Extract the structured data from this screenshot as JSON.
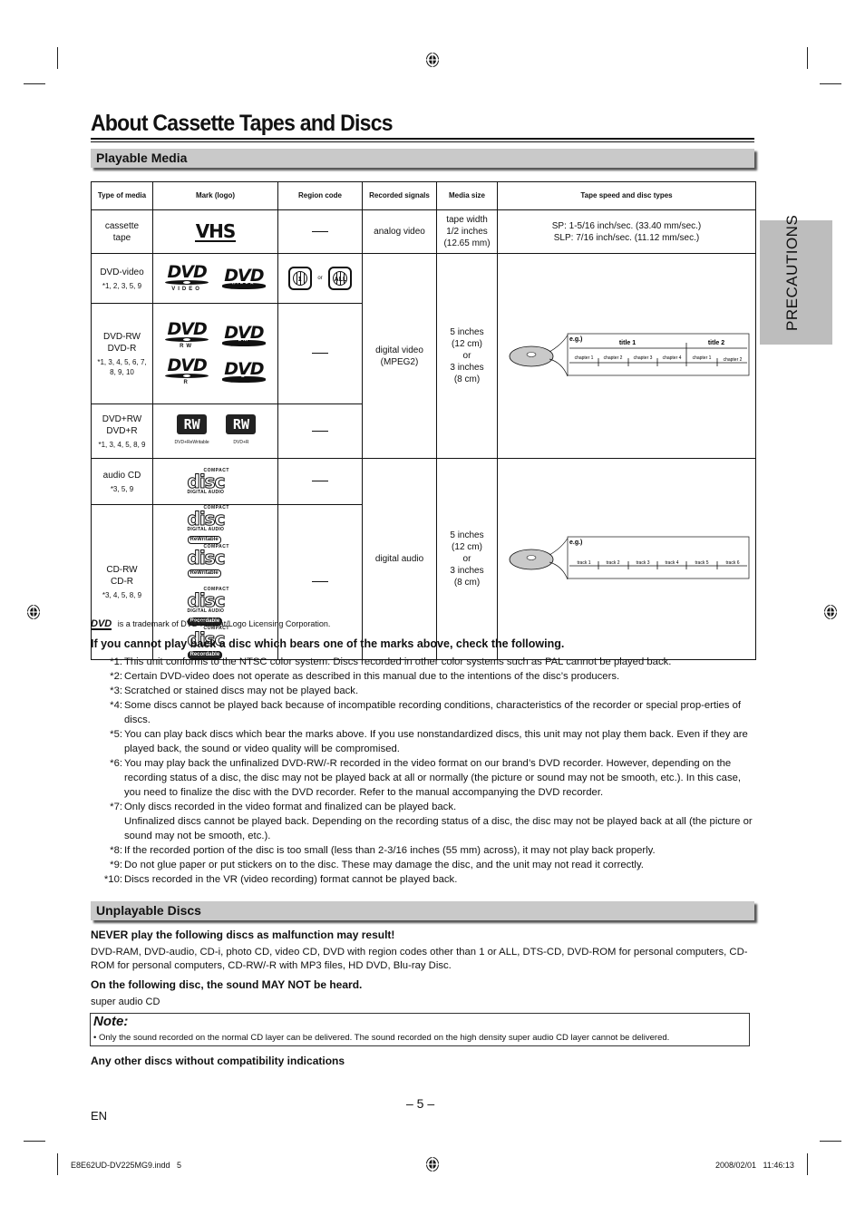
{
  "page_title": "About Cassette Tapes and Discs",
  "side_tab": "PRECAUTIONS",
  "sections": {
    "playable": "Playable Media",
    "unplayable": "Unplayable Discs"
  },
  "table": {
    "headers": [
      "Type of media",
      "Mark (logo)",
      "Region code",
      "Recorded signals",
      "Media size",
      "Tape speed and disc types"
    ],
    "rows": [
      {
        "type": "cassette tape",
        "footnotes": "",
        "logo": "VHS",
        "region": "—",
        "signals": "analog video",
        "size": "tape width 1/2 inches (12.65 mm)",
        "speed": [
          "SP: 1-5/16 inch/sec. (33.40 mm/sec.)",
          "SLP: 7/16 inch/sec. (11.12 mm/sec.)"
        ]
      },
      {
        "type": "DVD-video",
        "footnotes": "*1, 2, 3, 5, 9",
        "logos": [
          "DVD VIDEO",
          "DVD VIDEO"
        ],
        "region_codes": [
          "1",
          "ALL"
        ],
        "region_or": "or"
      },
      {
        "type_lines": [
          "DVD-RW",
          "DVD-R"
        ],
        "footnotes": "*1, 3, 4, 5, 6, 7, 8, 9, 10",
        "logos": [
          "DVD RW",
          "DVD RW",
          "DVD R",
          "DVD R"
        ],
        "region": "—"
      },
      {
        "type_lines": [
          "DVD+RW",
          "DVD+R"
        ],
        "footnotes": "*1, 3, 4, 5, 8, 9",
        "logos": [
          {
            "mark": "RW",
            "caption": "DVD+ReWritable"
          },
          {
            "mark": "RW",
            "caption": "DVD+R"
          }
        ],
        "region": "—"
      },
      {
        "type": "audio CD",
        "footnotes": "*3, 5, 9",
        "logo": {
          "top": "COMPACT",
          "word": "disc",
          "bottom": "DIGITAL AUDIO"
        },
        "region": "—"
      },
      {
        "type_lines": [
          "CD-RW",
          "CD-R"
        ],
        "footnotes": "*3, 4, 5, 8, 9",
        "logos": [
          {
            "top": "COMPACT",
            "word": "disc",
            "bottom": "DIGITAL AUDIO",
            "pill": "ReWritable"
          },
          {
            "top": "COMPACT",
            "word": "disc",
            "bottom": "",
            "pill": "ReWritable"
          },
          {
            "top": "COMPACT",
            "word": "disc",
            "bottom": "DIGITAL AUDIO",
            "pill": "Recordable"
          },
          {
            "top": "COMPACT",
            "word": "disc",
            "bottom": "",
            "pill": "Recordable"
          }
        ],
        "region": "—"
      }
    ],
    "dvd_group": {
      "signals": "digital video (MPEG2)",
      "size_lines": [
        "5 inches",
        "(12 cm)",
        "or",
        "3 inches",
        "(8 cm)"
      ]
    },
    "cd_group": {
      "signals": "digital audio",
      "size_lines": [
        "5 inches",
        "(12 cm)",
        "or",
        "3 inches",
        "(8 cm)"
      ]
    },
    "dvd_diagram": {
      "eg": "e.g.)",
      "titles": [
        "title 1",
        "title 2"
      ],
      "chapters": [
        "chapter 1",
        "chapter 2",
        "chapter 3",
        "chapter 4",
        "chapter 1",
        "chapter 2"
      ]
    },
    "cd_diagram": {
      "eg": "e.g.)",
      "tracks": [
        "track 1",
        "track 2",
        "track 3",
        "track 4",
        "track 5",
        "track 6"
      ]
    }
  },
  "trademark": {
    "logo": "DVD",
    "text": "is a trademark of DVD Format/Logo Licensing Corporation."
  },
  "check_heading": "If you cannot play back a disc which bears one of the marks above, check the following.",
  "notes": [
    {
      "key": "*1:",
      "text": "This unit conforms to the NTSC color system. Discs recorded in other color systems such as PAL cannot be played back."
    },
    {
      "key": "*2:",
      "text": "Certain DVD-video does not operate as described in this manual due to the intentions of the disc’s producers."
    },
    {
      "key": "*3:",
      "text": "Scratched or stained discs may not be played back."
    },
    {
      "key": "*4:",
      "text": "Some discs cannot be played back because of incompatible recording conditions, characteristics of the recorder or special prop-erties of discs."
    },
    {
      "key": "*5:",
      "text": "You can play back discs which bear the marks above. If you use nonstandardized discs, this unit may not play them back. Even if they are played back, the sound or video quality will be compromised."
    },
    {
      "key": "*6:",
      "text": "You may play back the unfinalized DVD-RW/-R recorded in the video format on our brand’s DVD recorder. However, depending on the recording status of a disc, the disc may not be played back at all or normally (the picture or sound may not be smooth, etc.). In this case, you need to finalize the disc with the DVD recorder. Refer to the manual accompanying the DVD recorder."
    },
    {
      "key": "*7:",
      "text": "Only discs recorded in the video format and finalized can be played back.",
      "extra": "Unfinalized discs cannot be played back. Depending on the recording status of a disc, the disc may not be played back at all (the picture or sound may not be smooth, etc.)."
    },
    {
      "key": "*8:",
      "text": "If the recorded portion of the disc is too small (less than 2-3/16 inches (55 mm) across), it may not play back properly."
    },
    {
      "key": "*9:",
      "text": "Do not glue paper or put stickers on to the disc. These may damage the disc, and the unit may not read it correctly."
    },
    {
      "key": "*10:",
      "text": "Discs recorded in the VR (video recording) format cannot be played back."
    }
  ],
  "unplayable": {
    "never_heading": "NEVER play the following discs as malfunction may result!",
    "never_text": "DVD-RAM, DVD-audio, CD-i, photo CD, video CD, DVD with region codes other than 1 or ALL, DTS-CD, DVD-ROM for personal computers, CD-ROM for personal computers, CD-RW/-R with MP3 files, HD DVD, Blu-ray Disc.",
    "may_heading": "On the following disc, the sound MAY NOT be heard.",
    "may_text": "super audio CD",
    "note_title": "Note:",
    "note_bullet": "• Only the sound recorded on the normal CD layer can be delivered. The sound recorded on the high density super audio CD layer cannot be delivered.",
    "any_heading": "Any other discs without compatibility indications"
  },
  "footer": {
    "page_number": "– 5 –",
    "language": "EN",
    "slug_left": "E8E62UD-DV225MG9.indd   5",
    "slug_right": "2008/02/01   11:46:13"
  }
}
